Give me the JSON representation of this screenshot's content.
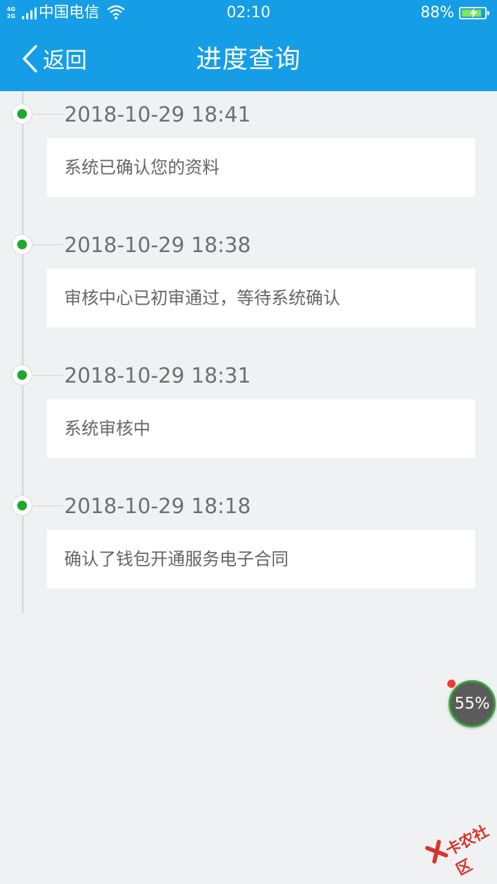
{
  "status_bar": {
    "network_top": "4G",
    "network_bottom": "2G",
    "carrier": "中国电信",
    "time": "02:10",
    "battery_percent_text": "88%",
    "battery_level": 0.88,
    "icons": [
      "signal-icon",
      "wifi-icon",
      "battery-charging-icon"
    ]
  },
  "nav": {
    "back_label": "返回",
    "title": "进度查询",
    "background_color": "#159ee6"
  },
  "timeline": [
    {
      "time": "2018-10-29 18:41",
      "text": "系统已确认您的资料"
    },
    {
      "time": "2018-10-29 18:38",
      "text": "审核中心已初审通过，等待系统确认"
    },
    {
      "time": "2018-10-29 18:31",
      "text": "系统审核中"
    },
    {
      "time": "2018-10-29 18:18",
      "text": "确认了钱包开通服务电子合同"
    }
  ],
  "floating_widget": {
    "percent": "55%"
  },
  "watermark": {
    "text": "卡农社区"
  },
  "colors": {
    "dot": "#1fa92c",
    "page_bg": "#f0f1f3",
    "timestamp": "#6f6f6f"
  }
}
